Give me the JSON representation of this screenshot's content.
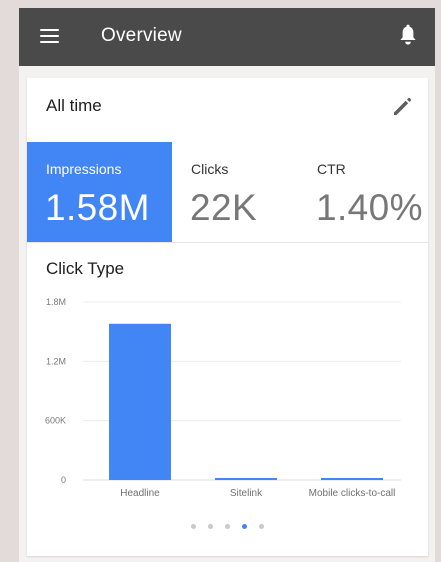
{
  "appbar": {
    "title": "Overview",
    "menu_icon": "menu-icon",
    "notification_icon": "bell-icon",
    "background_color": "#4a4a4a"
  },
  "summary": {
    "range_label": "All time",
    "edit_icon": "pencil-icon",
    "metrics": [
      {
        "label": "Impressions",
        "value": "1.58M",
        "selected": true
      },
      {
        "label": "Clicks",
        "value": "22K",
        "selected": false
      },
      {
        "label": "CTR",
        "value": "1.40%",
        "selected": false
      }
    ],
    "accent_color": "#4285f4"
  },
  "chart_section": {
    "title": "Click Type"
  },
  "chart_data": {
    "type": "bar",
    "title": "Click Type",
    "categories": [
      "Headline",
      "Sitelink",
      "Mobile clicks-to-call"
    ],
    "values": [
      1580000,
      7000,
      4000
    ],
    "ylim": [
      0,
      1800000
    ],
    "y_ticks": [
      "0",
      "600K",
      "1.2M",
      "1.8M"
    ],
    "bar_color": "#4285f4",
    "grid": true
  },
  "pager": {
    "count": 5,
    "active_index": 3
  }
}
